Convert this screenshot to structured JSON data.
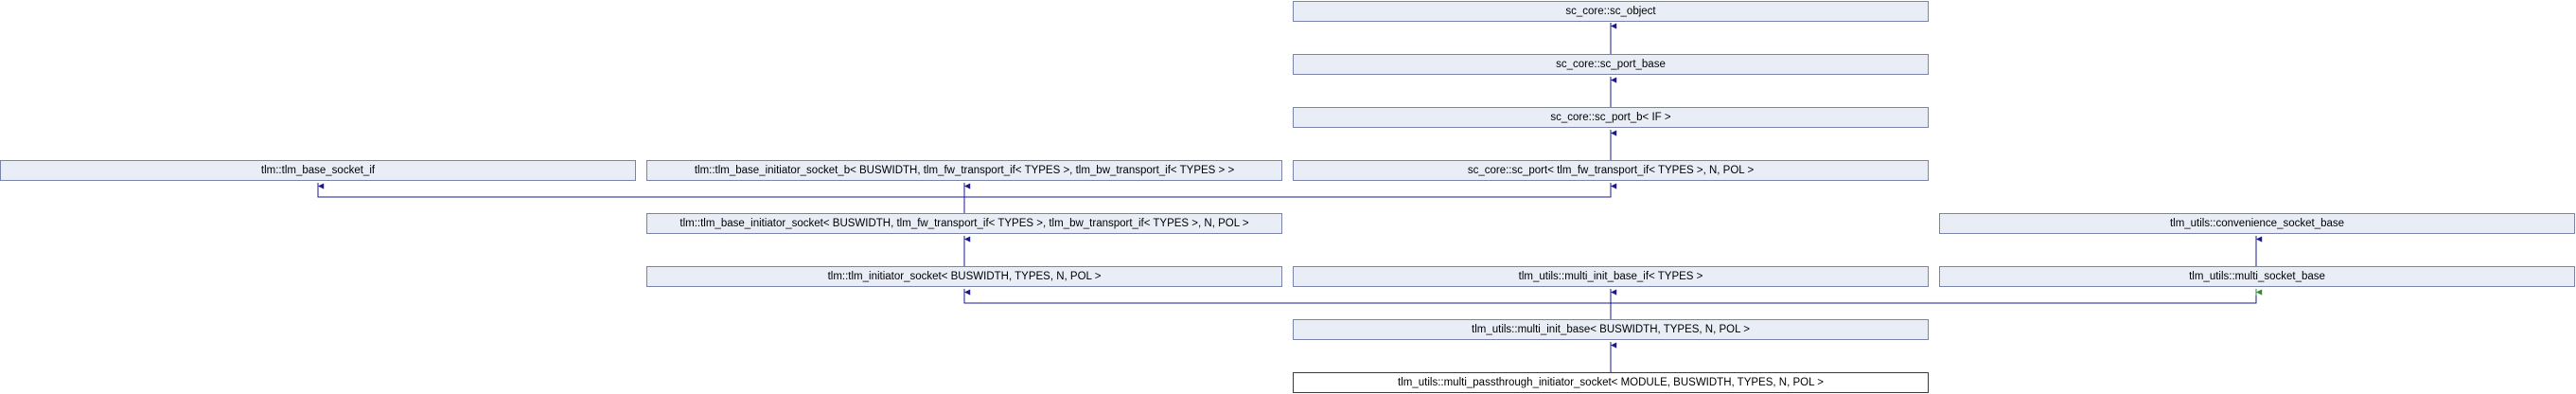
{
  "nodes": {
    "sc_object": "sc_core::sc_object",
    "sc_port_base": "sc_core::sc_port_base",
    "sc_port_b": "sc_core::sc_port_b< IF >",
    "tlm_base_socket_if": "tlm::tlm_base_socket_if",
    "tlm_base_initiator_socket_b": "tlm::tlm_base_initiator_socket_b< BUSWIDTH, tlm_fw_transport_if< TYPES >, tlm_bw_transport_if< TYPES > >",
    "sc_port": "sc_core::sc_port< tlm_fw_transport_if< TYPES >, N, POL >",
    "tlm_base_initiator_socket": "tlm::tlm_base_initiator_socket< BUSWIDTH, tlm_fw_transport_if< TYPES >, tlm_bw_transport_if< TYPES >, N, POL >",
    "convenience_socket_base": "tlm_utils::convenience_socket_base",
    "tlm_initiator_socket": "tlm::tlm_initiator_socket< BUSWIDTH, TYPES, N, POL >",
    "multi_init_base_if": "tlm_utils::multi_init_base_if< TYPES >",
    "multi_socket_base": "tlm_utils::multi_socket_base",
    "multi_init_base": "tlm_utils::multi_init_base< BUSWIDTH, TYPES, N, POL >",
    "multi_passthrough_initiator_socket": "tlm_utils::multi_passthrough_initiator_socket< MODULE, BUSWIDTH, TYPES, N, POL >"
  },
  "colors": {
    "node_fill": "#e8edf6",
    "node_border": "#7a83a8",
    "edge_public": "#1a1a8c",
    "edge_protected": "#2e8b2e"
  }
}
